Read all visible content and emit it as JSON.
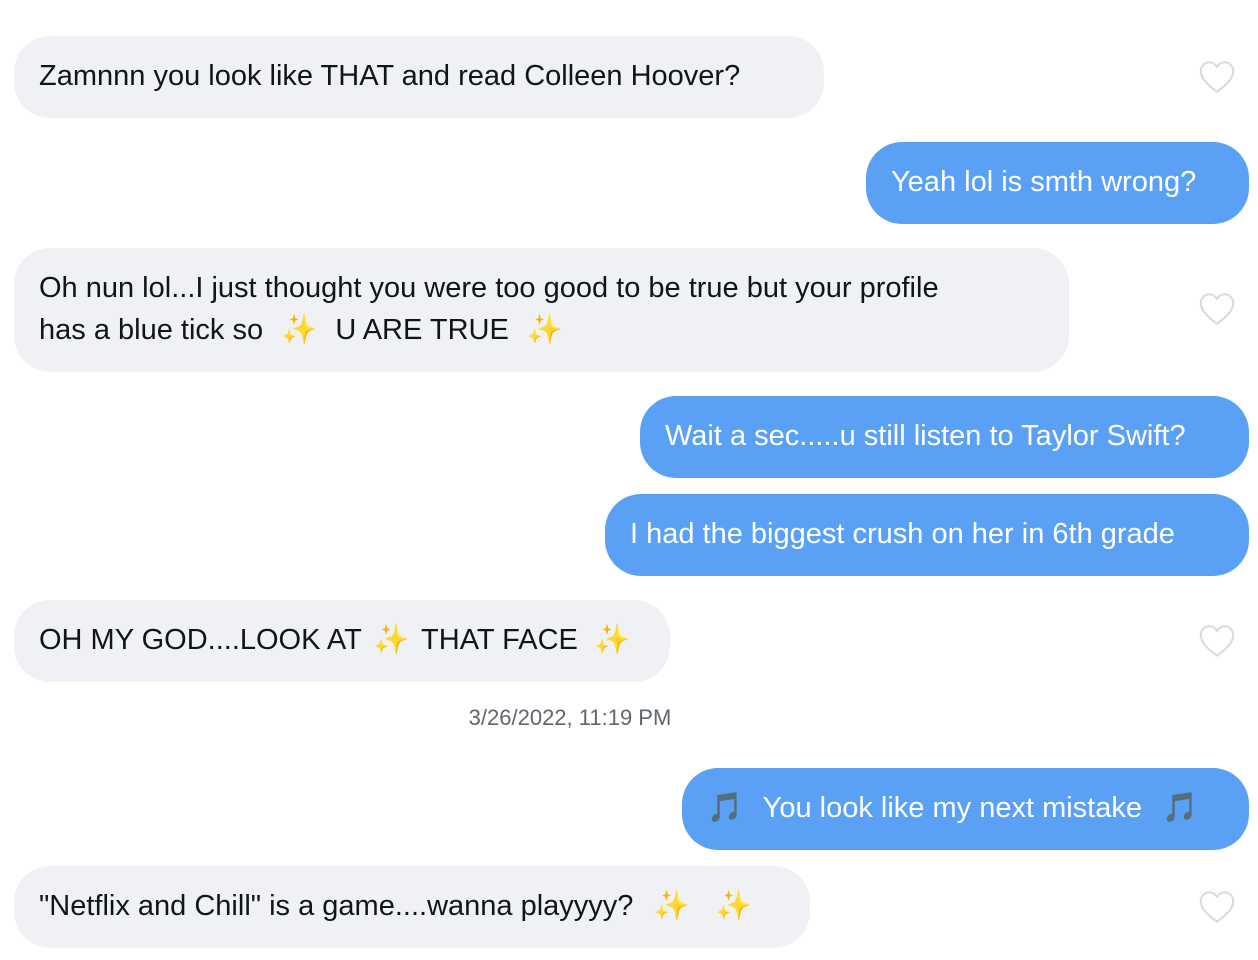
{
  "messages": {
    "m1": {
      "text": "Zamnnn you look like THAT and read Colleen Hoover?"
    },
    "m2": {
      "text": "Yeah lol is smth wrong?"
    },
    "m3": {
      "line1": "Oh nun lol...I just thought you were too good to be true but your profile",
      "line2_a": "has a blue tick so",
      "line2_b": "U ARE TRUE",
      "emoji": "✨"
    },
    "m4": {
      "text": "Wait a sec.....u still listen to Taylor Swift?"
    },
    "m5": {
      "text": "I had the biggest crush on her in 6th grade"
    },
    "m6": {
      "a": "OH MY GOD....LOOK AT",
      "b": "THAT FACE",
      "emoji": "✨"
    },
    "m7": {
      "text": "You look like my next mistake",
      "emoji": "🎵"
    },
    "m8": {
      "text": "\"Netflix and Chill\" is a game....wanna playyyy?",
      "emoji": "✨"
    }
  },
  "timestamp": "3/26/2022, 11:19 PM",
  "icons": {
    "like": "heart-outline-icon"
  },
  "colors": {
    "incoming_bubble": "#f0f1f4",
    "outgoing_bubble": "#5aa1f5",
    "heart_outline": "#d9dbe0"
  }
}
